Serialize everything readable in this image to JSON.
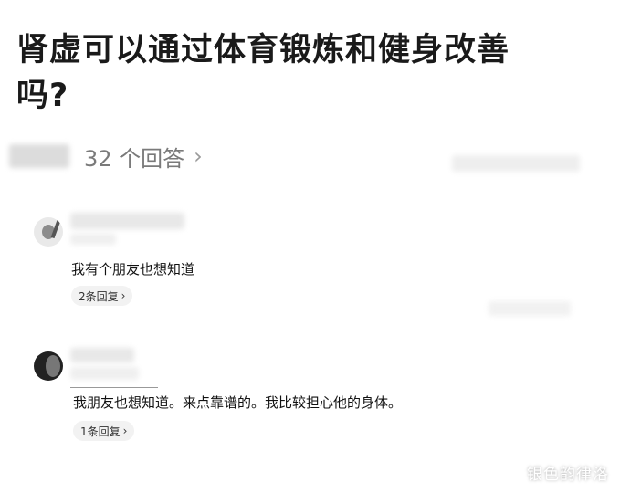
{
  "question": {
    "title": "肾虚可以通过体育锻炼和健身改善吗?"
  },
  "answers_link": {
    "count_text": "32 个回答",
    "chevron_icon": "chevron-right-icon"
  },
  "comments": [
    {
      "text": "我有个朋友也想知道",
      "reply_label": "2条回复",
      "reply_icon": "chevron-right-icon"
    },
    {
      "text": "我朋友也想知道。来点靠谱的。我比较担心他的身体。",
      "reply_label": "1条回复",
      "reply_icon": "chevron-right-icon"
    }
  ],
  "watermark": {
    "text": "银色韵律洛"
  }
}
